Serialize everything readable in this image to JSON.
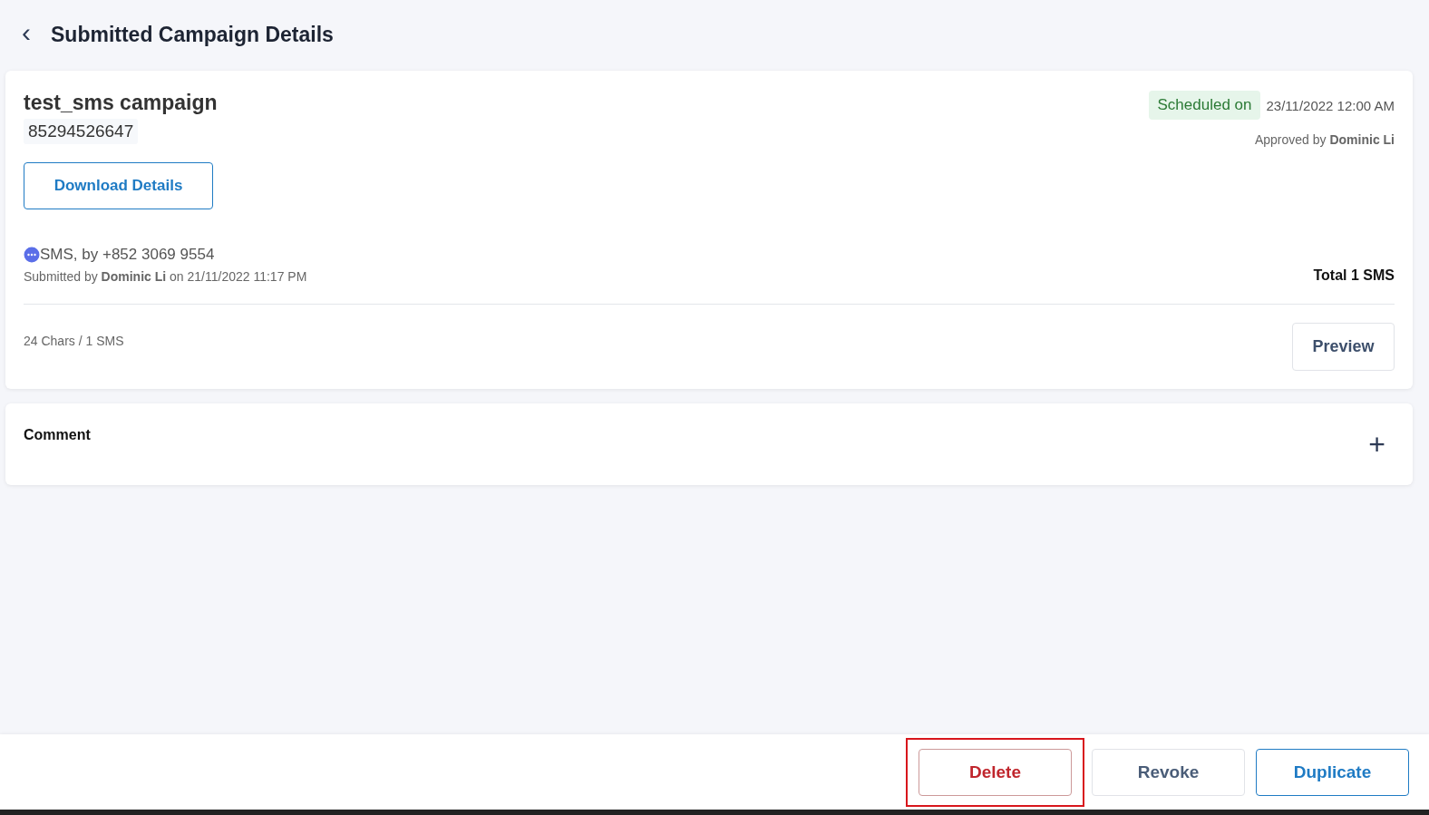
{
  "header": {
    "back": "‹",
    "title": "Submitted Campaign Details"
  },
  "campaign": {
    "name": "test_sms campaign",
    "code": "85294526647",
    "download_button": "Download Details",
    "status_badge": "Scheduled on",
    "scheduled_time": "23/11/2022 12:00 AM",
    "approved": "Approved by **Dominic Li**",
    "channel": "SMS, by +852 3069 9554",
    "submitted": "Submitted by **Dominic Li** on 21/11/2022 11:17 PM",
    "total": "Total 1 SMS",
    "char_count": "24 Chars / 1 SMS",
    "preview_button": "Preview"
  },
  "comment": {
    "label": "Comment",
    "add": "+"
  },
  "footer_buttons": [
    {
      "label": "Delete",
      "kind": "danger",
      "highlighted": true
    },
    {
      "label": "Revoke",
      "kind": "neutral",
      "highlighted": false
    },
    {
      "label": "Duplicate",
      "kind": "primary",
      "highlighted": false
    }
  ]
}
